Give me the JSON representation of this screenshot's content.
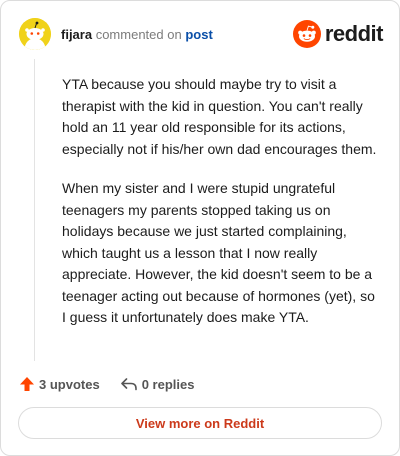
{
  "comment": {
    "author": "fijara",
    "action_text": "commented on",
    "post_link": "post",
    "paragraphs": [
      "YTA because you should maybe try to visit a therapist with the kid in question. You can't really hold an 11 year old responsible for its actions, especially not if his/her own dad encourages them.",
      "When my sister and I were stupid ungrateful teenagers my parents stopped taking us on holidays because we just started complaining, which taught us a lesson that I now really appreciate. However, the kid doesn't seem to be a teenager acting out because of hormones (yet), so I guess it unfortunately does make YTA."
    ]
  },
  "brand": {
    "wordmark": "reddit",
    "icon": "reddit-snoo-icon",
    "color": "#ff4500"
  },
  "actions": {
    "upvotes_label": "3 upvotes",
    "upvote_icon": "upvote-arrow-icon",
    "replies_label": "0 replies",
    "reply_icon": "reply-arrow-icon"
  },
  "footer": {
    "view_more_label": "View more on Reddit"
  },
  "colors": {
    "upvote": "#ff4500",
    "link": "#0a4fa8",
    "view_more": "#cc3a1b",
    "avatar_bg": "#f0d21a"
  }
}
